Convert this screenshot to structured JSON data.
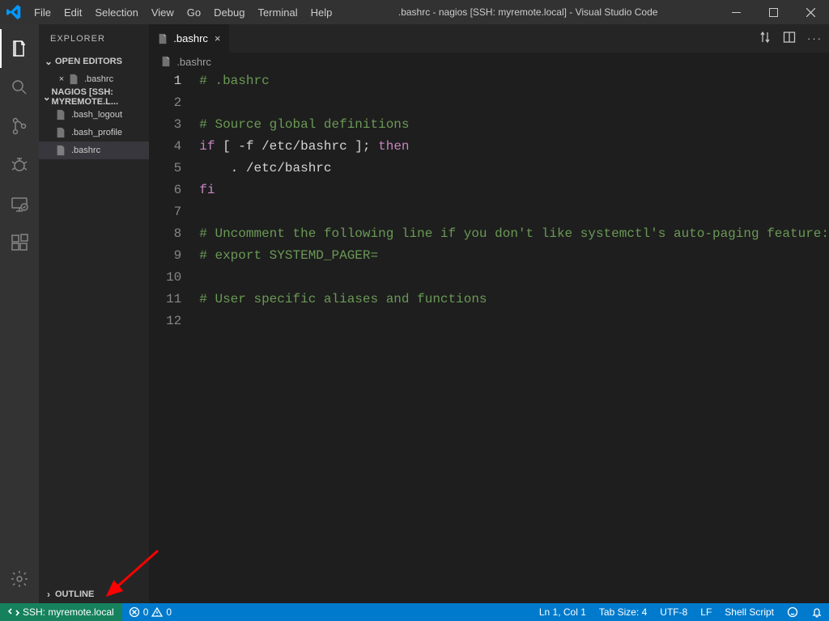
{
  "title": ".bashrc - nagios [SSH: myremote.local] - Visual Studio Code",
  "menus": [
    "File",
    "Edit",
    "Selection",
    "View",
    "Go",
    "Debug",
    "Terminal",
    "Help"
  ],
  "explorer": {
    "title": "EXPLORER",
    "open_editors_label": "OPEN EDITORS",
    "open_editors": [
      ".bashrc"
    ],
    "workspace_label": "NAGIOS [SSH: MYREMOTE.L...",
    "files": [
      ".bash_logout",
      ".bash_profile",
      ".bashrc"
    ],
    "outline_label": "OUTLINE"
  },
  "tab": {
    "label": ".bashrc"
  },
  "breadcrumb": ".bashrc",
  "code_lines": [
    {
      "n": 1,
      "segs": [
        {
          "c": "tok-comment",
          "t": "# .bashrc"
        }
      ]
    },
    {
      "n": 2,
      "segs": []
    },
    {
      "n": 3,
      "segs": [
        {
          "c": "tok-comment",
          "t": "# Source global definitions"
        }
      ]
    },
    {
      "n": 4,
      "segs": [
        {
          "c": "tok-keyword",
          "t": "if"
        },
        {
          "c": "tok-default",
          "t": " [ -f /etc/bashrc ]; "
        },
        {
          "c": "tok-keyword",
          "t": "then"
        }
      ]
    },
    {
      "n": 5,
      "segs": [
        {
          "c": "tok-default",
          "t": "    . /etc/bashrc"
        }
      ]
    },
    {
      "n": 6,
      "segs": [
        {
          "c": "tok-keyword",
          "t": "fi"
        }
      ]
    },
    {
      "n": 7,
      "segs": []
    },
    {
      "n": 8,
      "segs": [
        {
          "c": "tok-comment",
          "t": "# Uncomment the following line if you don't like systemctl's auto-paging feature:"
        }
      ]
    },
    {
      "n": 9,
      "segs": [
        {
          "c": "tok-comment",
          "t": "# export SYSTEMD_PAGER="
        }
      ]
    },
    {
      "n": 10,
      "segs": []
    },
    {
      "n": 11,
      "segs": [
        {
          "c": "tok-comment",
          "t": "# User specific aliases and functions"
        }
      ]
    },
    {
      "n": 12,
      "segs": []
    }
  ],
  "status": {
    "remote": "SSH: myremote.local",
    "errors": "0",
    "warnings": "0",
    "ln_col": "Ln 1, Col 1",
    "tab_size": "Tab Size: 4",
    "encoding": "UTF-8",
    "eol": "LF",
    "lang": "Shell Script"
  }
}
